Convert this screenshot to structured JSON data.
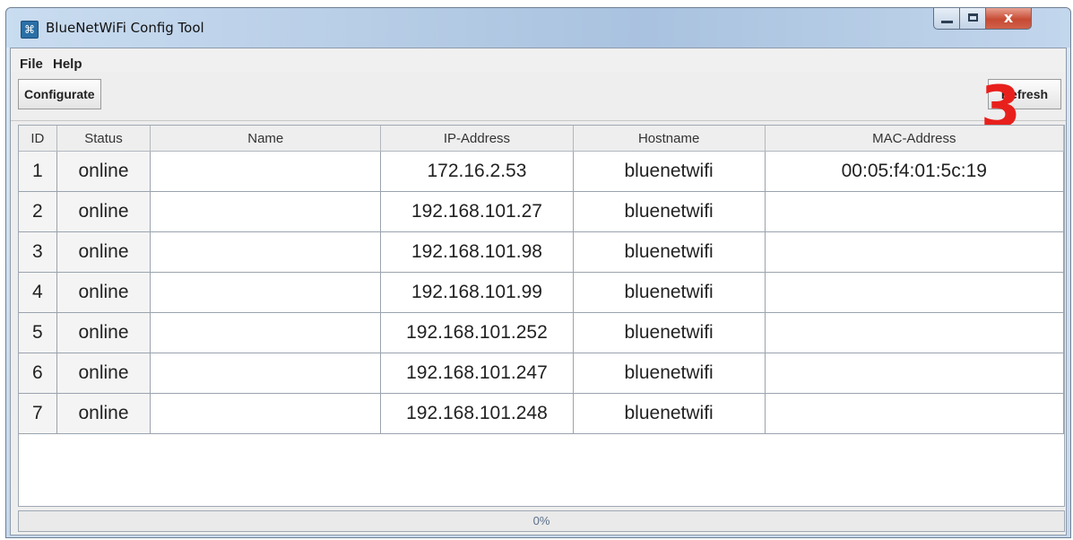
{
  "window": {
    "title": "BlueNetWiFi Config Tool",
    "close_label": "x"
  },
  "menu": [
    "File",
    "Help"
  ],
  "toolbar": {
    "configurate_label": "Configurate",
    "refresh_label": "Refresh"
  },
  "annotation_number": "3",
  "table": {
    "columns": [
      "ID",
      "Status",
      "Name",
      "IP-Address",
      "Hostname",
      "MAC-Address"
    ],
    "rows": [
      {
        "id": "1",
        "status": "online",
        "name": "",
        "ip": "172.16.2.53",
        "hostname": "bluenetwifi",
        "mac": "00:05:f4:01:5c:19"
      },
      {
        "id": "2",
        "status": "online",
        "name": "",
        "ip": "192.168.101.27",
        "hostname": "bluenetwifi",
        "mac": ""
      },
      {
        "id": "3",
        "status": "online",
        "name": "",
        "ip": "192.168.101.98",
        "hostname": "bluenetwifi",
        "mac": ""
      },
      {
        "id": "4",
        "status": "online",
        "name": "",
        "ip": "192.168.101.99",
        "hostname": "bluenetwifi",
        "mac": ""
      },
      {
        "id": "5",
        "status": "online",
        "name": "",
        "ip": "192.168.101.252",
        "hostname": "bluenetwifi",
        "mac": ""
      },
      {
        "id": "6",
        "status": "online",
        "name": "",
        "ip": "192.168.101.247",
        "hostname": "bluenetwifi",
        "mac": ""
      },
      {
        "id": "7",
        "status": "online",
        "name": "",
        "ip": "192.168.101.248",
        "hostname": "bluenetwifi",
        "mac": ""
      }
    ]
  },
  "progress": {
    "text": "0%",
    "value": 0
  },
  "colors": {
    "annotation": "#e8201c",
    "close_button": "#c74a33"
  }
}
